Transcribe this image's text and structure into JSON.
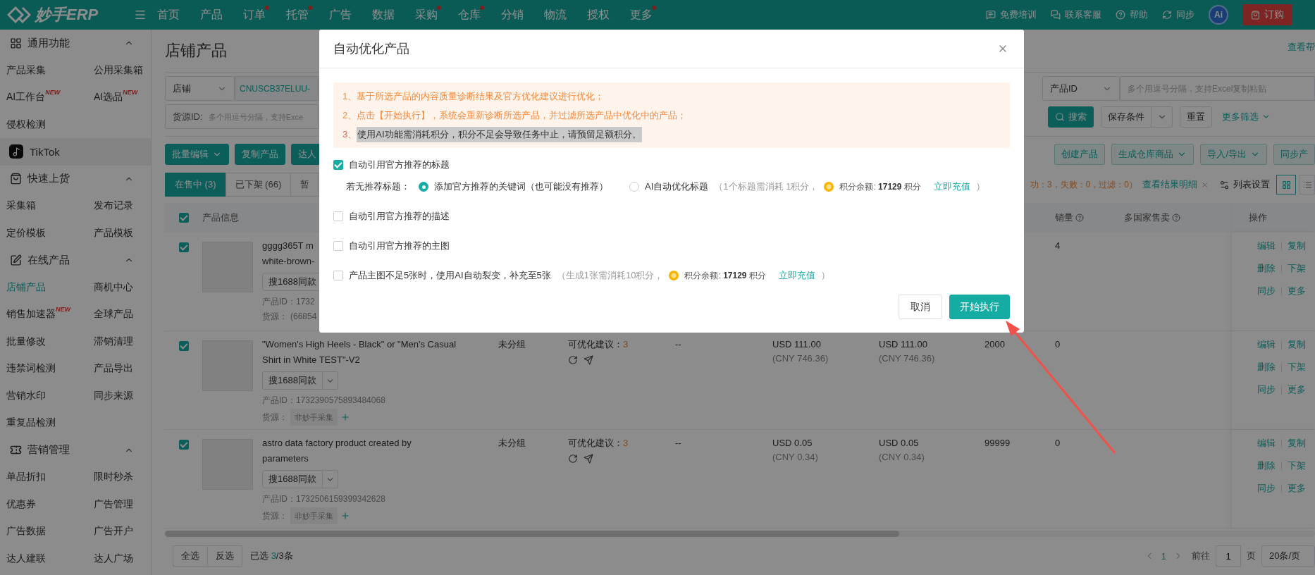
{
  "topbar": {
    "logo": "妙手ERP",
    "nav": [
      {
        "label": "首页",
        "dot": false
      },
      {
        "label": "产品",
        "dot": false
      },
      {
        "label": "订单",
        "dot": true
      },
      {
        "label": "托管",
        "dot": true
      },
      {
        "label": "广告",
        "dot": false
      },
      {
        "label": "数据",
        "dot": false
      },
      {
        "label": "采购",
        "dot": true
      },
      {
        "label": "仓库",
        "dot": true
      },
      {
        "label": "分销",
        "dot": false
      },
      {
        "label": "物流",
        "dot": false
      },
      {
        "label": "授权",
        "dot": false
      },
      {
        "label": "更多",
        "dot": true
      }
    ],
    "links": [
      "免费培训",
      "联系客服",
      "帮助",
      "同步"
    ],
    "avatar": "Ai",
    "order_button": "订购"
  },
  "sidebar": [
    {
      "kind": "section",
      "title": "通用功能",
      "expanded": true,
      "items": [
        {
          "label": "产品采集",
          "selected": false
        },
        {
          "label": "公用采集箱",
          "selected": false
        },
        {
          "label": "AI工作台",
          "badge": "NEW",
          "selected": false
        },
        {
          "label": "AI选品",
          "badge": "NEW",
          "selected": false
        },
        {
          "label": "侵权检测",
          "selected": false
        }
      ]
    },
    {
      "kind": "platform",
      "title": "TikTok"
    },
    {
      "kind": "section",
      "title": "快速上货",
      "expanded": true,
      "items": [
        {
          "label": "采集箱",
          "selected": false
        },
        {
          "label": "发布记录",
          "selected": false
        },
        {
          "label": "定价模板",
          "selected": false
        },
        {
          "label": "产品模板",
          "selected": false
        }
      ]
    },
    {
      "kind": "section",
      "title": "在线产品",
      "expanded": true,
      "items": [
        {
          "label": "店铺产品",
          "selected": true
        },
        {
          "label": "商机中心",
          "selected": false
        },
        {
          "label": "销售加速器",
          "badge": "NEW",
          "selected": false
        },
        {
          "label": "全球产品",
          "selected": false
        },
        {
          "label": "批量修改",
          "selected": false
        },
        {
          "label": "滞销清理",
          "selected": false
        },
        {
          "label": "违禁词检测",
          "selected": false
        },
        {
          "label": "产品导出",
          "selected": false
        },
        {
          "label": "营销水印",
          "selected": false
        },
        {
          "label": "同步来源",
          "selected": false
        },
        {
          "label": "重复品检测",
          "selected": false
        }
      ]
    },
    {
      "kind": "section",
      "title": "营销管理",
      "expanded": true,
      "items": [
        {
          "label": "单品折扣",
          "selected": false
        },
        {
          "label": "限时秒杀",
          "selected": false
        },
        {
          "label": "优惠券",
          "selected": false
        },
        {
          "label": "广告管理",
          "selected": false
        },
        {
          "label": "广告数据",
          "selected": false
        },
        {
          "label": "广告开户",
          "selected": false
        },
        {
          "label": "达人建联",
          "selected": false
        },
        {
          "label": "达人广场",
          "selected": false
        }
      ]
    }
  ],
  "page": {
    "title": "店铺产品",
    "help_link": "查看帮"
  },
  "filters": {
    "shop_label": "店铺",
    "shop_value": "CNUSCB37ELUU-",
    "source_label": "货源ID:",
    "source_placeholder": "多个用逗号分隔，支持Exce",
    "id_label": "产品ID",
    "id_placeholder": "多个用逗号分隔，支持Excel复制粘贴",
    "search": "搜索",
    "save": "保存条件",
    "reset": "重置",
    "more": "更多筛选"
  },
  "toolbar": {
    "left": [
      {
        "label": "批量编辑",
        "kind": "primary",
        "dropdown": true
      },
      {
        "label": "复制产品",
        "kind": "primary",
        "dropdown": false
      },
      {
        "label": "达人",
        "kind": "primary",
        "dropdown": false
      }
    ],
    "right": [
      {
        "label": "创建产品",
        "kind": "plain",
        "dropdown": false
      },
      {
        "label": "生成仓库商品",
        "kind": "plain",
        "dropdown": true
      },
      {
        "label": "导入/导出",
        "kind": "plain",
        "dropdown": true
      },
      {
        "label": "同步产",
        "kind": "plain",
        "dropdown": false
      }
    ]
  },
  "tabs": [
    {
      "label": "在售中 (3)",
      "selected": true
    },
    {
      "label": "已下架 (66)",
      "selected": false
    },
    {
      "label": "暂",
      "selected": false
    }
  ],
  "task": {
    "summary": "功：3，失败：0，过滤：0）",
    "link": "查看结果明细",
    "settings": "列表设置"
  },
  "table": {
    "header_checked": true,
    "columns": {
      "product": "产品信息",
      "sales": "销量",
      "multi_country": "多国家售卖",
      "actions": "操作"
    },
    "rows": [
      {
        "checked": true,
        "title_lines": [
          "gggg365T m",
          "white-brown-"
        ],
        "search_button": "搜1688同款",
        "dropdown": false,
        "product_id": "产品ID：1732",
        "source_label": "货源：",
        "source": {
          "kind": "text",
          "value": "(66854"
        },
        "sales": "4",
        "actions": [
          "编辑",
          "复制",
          "删除",
          "下架",
          "同步",
          "更多"
        ]
      },
      {
        "checked": true,
        "title_lines": [
          "\"Women's High Heels - Black\" or \"Men's Casual",
          "Shirt in White TEST\"-V2"
        ],
        "search_button": "搜1688同款",
        "dropdown": true,
        "product_id": "产品ID：1732390575893484068",
        "source_label": "货源：",
        "source": {
          "kind": "tag",
          "value": "非妙手采集"
        },
        "group": "未分组",
        "suggestion": {
          "label": "可优化建议：",
          "count": "3"
        },
        "dash": "--",
        "price": {
          "usd": "USD 111.00",
          "cny": "(CNY 746.36)"
        },
        "price_2": {
          "usd": "USD 111.00",
          "cny": "(CNY 746.36)"
        },
        "stock": "2000",
        "sales": "0",
        "actions": [
          "编辑",
          "复制",
          "删除",
          "下架",
          "同步",
          "更多"
        ]
      },
      {
        "checked": true,
        "title_lines": [
          "astro data factory product created by",
          "parameters"
        ],
        "search_button": "搜1688同款",
        "dropdown": true,
        "product_id": "产品ID：1732506159399342628",
        "source_label": "货源：",
        "source": {
          "kind": "tag",
          "value": "非妙手采集"
        },
        "group": "未分组",
        "suggestion": {
          "label": "可优化建议：",
          "count": "3"
        },
        "dash": "--",
        "price": {
          "usd": "USD 0.05",
          "cny": "(CNY 0.34)"
        },
        "price_2": {
          "usd": "USD 0.05",
          "cny": "(CNY 0.34)"
        },
        "stock": "99999",
        "sales": "0",
        "actions": [
          "编辑",
          "复制",
          "删除",
          "下架",
          "同步",
          "更多"
        ]
      }
    ]
  },
  "footer": {
    "select_all": "全选",
    "invert": "反选",
    "selected": {
      "label": "已选 ",
      "count": "3",
      "total": "/3条"
    },
    "pages": [
      {
        "label": "1",
        "selected": true
      }
    ],
    "goto_label": "前往",
    "goto_value": "1",
    "page_unit": "页",
    "page_size": "20条/页"
  },
  "modal": {
    "title": "自动优化产品",
    "notices": [
      {
        "number": "1、",
        "text": "基于所选产品的内容质量诊断结果及官方优化建议进行优化；",
        "highlighted": false
      },
      {
        "number": "2、",
        "text": "点击【开始执行】，系统会重新诊断所选产品，并过滤所选产品中优化中的产品；",
        "highlighted": false
      },
      {
        "number": "3、",
        "text": "使用AI功能需消耗积分，积分不足会导致任务中止，请预留足额积分。",
        "highlighted": true
      }
    ],
    "options": [
      {
        "label": "自动引用官方推荐的标题",
        "checked": true,
        "fallback": {
          "label": "若无推荐标题：",
          "radios": [
            {
              "label": "添加官方推荐的关键词（也可能没有推荐）",
              "selected": true
            },
            {
              "label": "AI自动优化标题",
              "selected": false,
              "cost": {
                "note": "（1个标题需消耗 1积分，",
                "balance": "积分余额: **17129** 积分",
                "link": "立即充值",
                "close": "）"
              }
            }
          ]
        }
      },
      {
        "label": "自动引用官方推荐的描述",
        "checked": false
      },
      {
        "label": "自动引用官方推荐的主图",
        "checked": false
      },
      {
        "label": "产品主图不足5张时，使用AI自动裂变，补充至5张",
        "checked": false,
        "cost": {
          "note": "（生成1张需消耗10积分，",
          "balance": "积分余额: **17129** 积分",
          "link": "立即充值",
          "close": "）"
        }
      }
    ],
    "buttons": [
      {
        "label": "取消",
        "kind": "default"
      },
      {
        "label": "开始执行",
        "kind": "primary"
      }
    ]
  }
}
